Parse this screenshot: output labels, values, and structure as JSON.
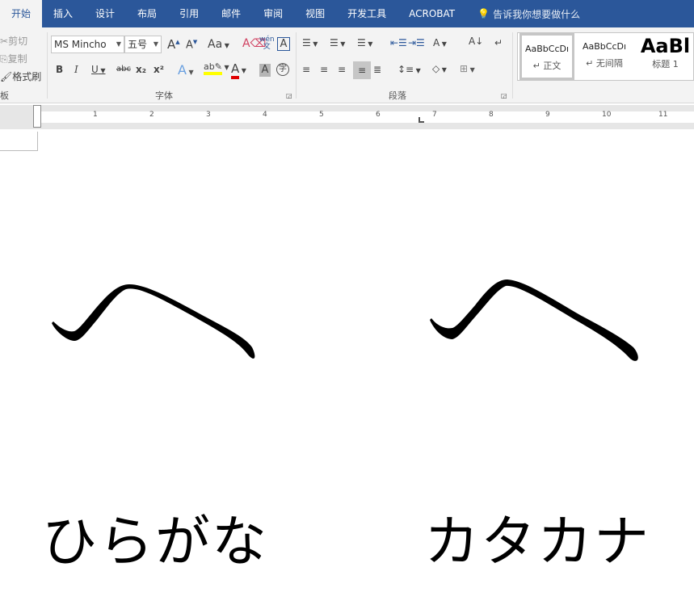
{
  "tabs": [
    "开始",
    "插入",
    "设计",
    "布局",
    "引用",
    "邮件",
    "审阅",
    "视图",
    "开发工具",
    "ACROBAT"
  ],
  "tell_me": "告诉我你想要做什么",
  "clipboard": {
    "cut": "剪切",
    "copy": "复制",
    "format_painter": "格式刷",
    "label": "板"
  },
  "font": {
    "name": "MS Mincho",
    "size": "五号",
    "label": "字体",
    "change_case": "Aa",
    "bold": "B",
    "italic": "I",
    "underline": "U",
    "strike": "abc",
    "sub": "x₂",
    "sup": "x²",
    "font_color": "A",
    "pinyin": "wén",
    "enclose": "字"
  },
  "paragraph": {
    "label": "段落"
  },
  "styles": [
    {
      "preview": "AaBbCcDı",
      "name": "↵ 正文"
    },
    {
      "preview": "AaBbCcDı",
      "name": "↵ 无间隔"
    },
    {
      "preview": "AaBl",
      "name": "标题 1"
    }
  ],
  "ruler": [
    "1",
    "2",
    "3",
    "4",
    "5",
    "6",
    "7",
    "8",
    "9",
    "10",
    "11"
  ],
  "document": {
    "glyph_left": "へ",
    "glyph_right": "ヘ",
    "hiragana": "ひらがな",
    "katakana": "カタカナ"
  },
  "colors": {
    "accent": "#2b579a",
    "highlight": "#ffff00",
    "font_color": "#e00000"
  }
}
